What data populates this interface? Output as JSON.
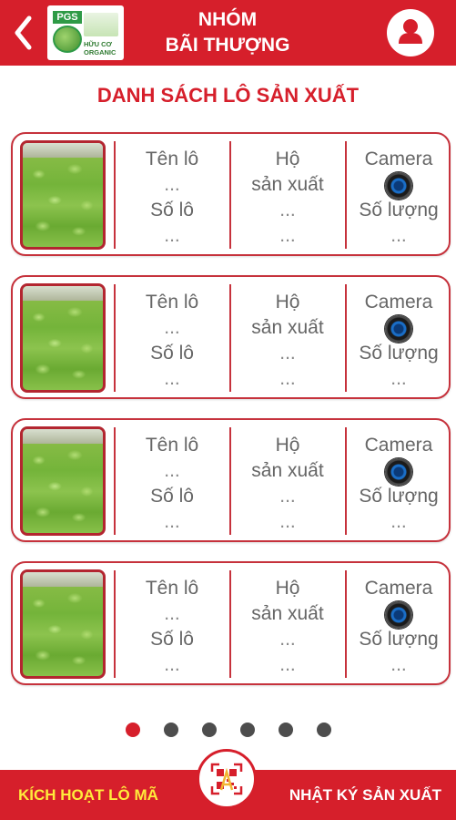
{
  "header": {
    "title_line1": "NHÓM",
    "title_line2": "BÃI THƯỢNG",
    "logo_pgs_text": "PGS",
    "logo_organic_line1": "HỮU CƠ",
    "logo_organic_line2": "ORGANIC",
    "back_icon": "chevron-left-icon",
    "user_icon": "user-icon"
  },
  "section_title": "DANH SÁCH LÔ SẢN XUẤT",
  "lots": [
    {
      "name_label": "Tên lô",
      "name_value": "...",
      "number_label": "Số lô",
      "number_value": "...",
      "household_label_1": "Hộ",
      "household_label_2": "sản xuất",
      "household_value_1": "...",
      "household_value_2": "...",
      "camera_label": "Camera",
      "quantity_label": "Số lượng",
      "quantity_value": "..."
    },
    {
      "name_label": "Tên lô",
      "name_value": "...",
      "number_label": "Số lô",
      "number_value": "...",
      "household_label_1": "Hộ",
      "household_label_2": "sản xuất",
      "household_value_1": "...",
      "household_value_2": "...",
      "camera_label": "Camera",
      "quantity_label": "Số lượng",
      "quantity_value": "..."
    },
    {
      "name_label": "Tên lô",
      "name_value": "...",
      "number_label": "Số lô",
      "number_value": "...",
      "household_label_1": "Hộ",
      "household_label_2": "sản xuất",
      "household_value_1": "...",
      "household_value_2": "...",
      "camera_label": "Camera",
      "quantity_label": "Số lượng",
      "quantity_value": "..."
    },
    {
      "name_label": "Tên lô",
      "name_value": "...",
      "number_label": "Số lô",
      "number_value": "...",
      "household_label_1": "Hộ",
      "household_label_2": "sản xuất",
      "household_value_1": "...",
      "household_value_2": "...",
      "camera_label": "Camera",
      "quantity_label": "Số lượng",
      "quantity_value": "..."
    }
  ],
  "pagination": {
    "total_pages": 6,
    "current_page": 1
  },
  "bottom_bar": {
    "activate_label": "KÍCH HOẠT LÔ MÃ",
    "diary_label": "NHẬT KÝ SẢN XUẤT",
    "qr_icon": "qr-code-icon"
  },
  "colors": {
    "primary": "#d61f2b",
    "activate_text": "#ffeb3b",
    "card_border": "#c6323c"
  }
}
